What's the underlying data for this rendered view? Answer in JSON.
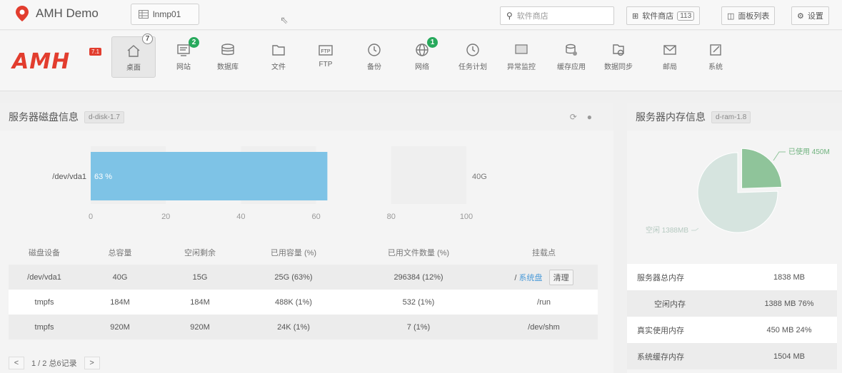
{
  "app": {
    "title": "AMH Demo",
    "tab_label": "lnmp01",
    "search_placeholder": "软件商店",
    "store_button": "软件商店",
    "store_count": "113",
    "panel_list_button": "面板列表",
    "settings_button": "设置",
    "colors": {
      "brand": "#e23d2e",
      "bar": "#7ec3e6",
      "badge": "#27a95c",
      "pie_used": "#8fc49a",
      "pie_free": "#d6e4df"
    }
  },
  "logo": {
    "text": "AMH",
    "version": "7.1"
  },
  "nav": [
    {
      "label": "桌面",
      "icon": "home-icon",
      "badge": "7"
    },
    {
      "label": "网站",
      "icon": "website-icon",
      "badge": "2"
    },
    {
      "label": "数据库",
      "icon": "database-icon",
      "badge": ""
    },
    {
      "label": "文件",
      "icon": "folder-icon",
      "badge": ""
    },
    {
      "label": "FTP",
      "icon": "ftp-icon",
      "badge": "",
      "icon_text": "FTP"
    },
    {
      "label": "备份",
      "icon": "backup-icon",
      "badge": ""
    },
    {
      "label": "网络",
      "icon": "globe-icon",
      "badge": "1"
    },
    {
      "label": "任务计划",
      "icon": "clock-icon",
      "badge": ""
    },
    {
      "label": "异常监控",
      "icon": "monitor-icon",
      "badge": ""
    },
    {
      "label": "缓存应用",
      "icon": "cache-icon",
      "badge": ""
    },
    {
      "label": "数据同步",
      "icon": "sync-icon",
      "badge": ""
    },
    {
      "label": "邮局",
      "icon": "mail-icon",
      "badge": ""
    },
    {
      "label": "系统",
      "icon": "system-icon",
      "badge": ""
    }
  ],
  "disk": {
    "title": "服务器磁盘信息",
    "tag": "d-disk-1.7",
    "headers": [
      "磁盘设备",
      "总容量",
      "空闲剩余",
      "已用容量 (%)",
      "已用文件数量 (%)",
      "挂载点"
    ],
    "rows": [
      {
        "device": "/dev/vda1",
        "total": "40G",
        "free": "15G",
        "used": "25G (63%)",
        "files": "296384 (12%)",
        "mount": "/",
        "mount_link": "系统盘",
        "action": "清理"
      },
      {
        "device": "tmpfs",
        "total": "184M",
        "free": "184M",
        "used": "488K (1%)",
        "files": "532 (1%)",
        "mount": "/run"
      },
      {
        "device": "tmpfs",
        "total": "920M",
        "free": "920M",
        "used": "24K (1%)",
        "files": "7 (1%)",
        "mount": "/dev/shm"
      }
    ],
    "pager": {
      "prev": "<",
      "next": ">",
      "info": "1 / 2 总6记录"
    }
  },
  "chart_data": [
    {
      "type": "bar",
      "orientation": "horizontal",
      "categories": [
        "/dev/vda1"
      ],
      "values": [
        63
      ],
      "data_labels": [
        "63 %"
      ],
      "end_label": "40G",
      "xlim": [
        0,
        100
      ],
      "xticks": [
        0,
        20,
        40,
        60,
        80,
        100
      ]
    },
    {
      "type": "pie",
      "slices": [
        {
          "label": "已使用 450M",
          "value": 450
        },
        {
          "label": "空闲 1388MB",
          "value": 1388
        }
      ]
    }
  ],
  "memory": {
    "title": "服务器内存信息",
    "tag": "d-ram-1.8",
    "rows": [
      {
        "label": "服务器总内存",
        "value": "1838 MB"
      },
      {
        "label": "空闲内存",
        "value": "1388 MB  76%"
      },
      {
        "label": "真实使用内存",
        "value": "450 MB  24%"
      },
      {
        "label": "系统缓存内存",
        "value": "1504 MB"
      }
    ]
  }
}
